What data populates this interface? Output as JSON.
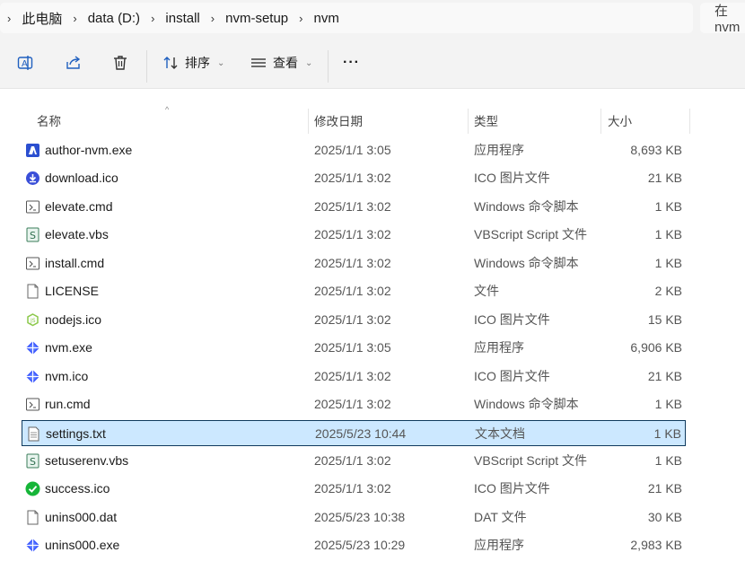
{
  "breadcrumb": [
    "此电脑",
    "data (D:)",
    "install",
    "nvm-setup",
    "nvm"
  ],
  "search": {
    "placeholder": "在 nvm"
  },
  "toolbar": {
    "sort_label": "排序",
    "view_label": "查看",
    "more_label": "···"
  },
  "columns": {
    "name": "名称",
    "date": "修改日期",
    "type": "类型",
    "size": "大小"
  },
  "files": [
    {
      "name": "author-nvm.exe",
      "date": "2025/1/1 3:05",
      "type": "应用程序",
      "size": "8,693 KB",
      "icon": "author-app-icon"
    },
    {
      "name": "download.ico",
      "date": "2025/1/1 3:02",
      "type": "ICO 图片文件",
      "size": "21 KB",
      "icon": "download-icon"
    },
    {
      "name": "elevate.cmd",
      "date": "2025/1/1 3:02",
      "type": "Windows 命令脚本",
      "size": "1 KB",
      "icon": "cmd-script-icon"
    },
    {
      "name": "elevate.vbs",
      "date": "2025/1/1 3:02",
      "type": "VBScript Script 文件",
      "size": "1 KB",
      "icon": "vbs-script-icon"
    },
    {
      "name": "install.cmd",
      "date": "2025/1/1 3:02",
      "type": "Windows 命令脚本",
      "size": "1 KB",
      "icon": "cmd-script-icon"
    },
    {
      "name": "LICENSE",
      "date": "2025/1/1 3:02",
      "type": "文件",
      "size": "2 KB",
      "icon": "blank-file-icon"
    },
    {
      "name": "nodejs.ico",
      "date": "2025/1/1 3:02",
      "type": "ICO 图片文件",
      "size": "15 KB",
      "icon": "nodejs-icon"
    },
    {
      "name": "nvm.exe",
      "date": "2025/1/1 3:05",
      "type": "应用程序",
      "size": "6,906 KB",
      "icon": "nvm-app-icon"
    },
    {
      "name": "nvm.ico",
      "date": "2025/1/1 3:02",
      "type": "ICO 图片文件",
      "size": "21 KB",
      "icon": "nvm-app-icon"
    },
    {
      "name": "run.cmd",
      "date": "2025/1/1 3:02",
      "type": "Windows 命令脚本",
      "size": "1 KB",
      "icon": "cmd-script-icon"
    },
    {
      "name": "settings.txt",
      "date": "2025/5/23 10:44",
      "type": "文本文档",
      "size": "1 KB",
      "icon": "text-file-icon",
      "selected": true
    },
    {
      "name": "setuserenv.vbs",
      "date": "2025/1/1 3:02",
      "type": "VBScript Script 文件",
      "size": "1 KB",
      "icon": "vbs-script-icon"
    },
    {
      "name": "success.ico",
      "date": "2025/1/1 3:02",
      "type": "ICO 图片文件",
      "size": "21 KB",
      "icon": "success-check-icon"
    },
    {
      "name": "unins000.dat",
      "date": "2025/5/23 10:38",
      "type": "DAT 文件",
      "size": "30 KB",
      "icon": "blank-file-icon"
    },
    {
      "name": "unins000.exe",
      "date": "2025/5/23 10:29",
      "type": "应用程序",
      "size": "2,983 KB",
      "icon": "nvm-app-icon"
    }
  ],
  "colors": {
    "selection_bg": "#cce8ff",
    "selection_border": "#0f3a5e",
    "accent": "#3d5afe"
  }
}
